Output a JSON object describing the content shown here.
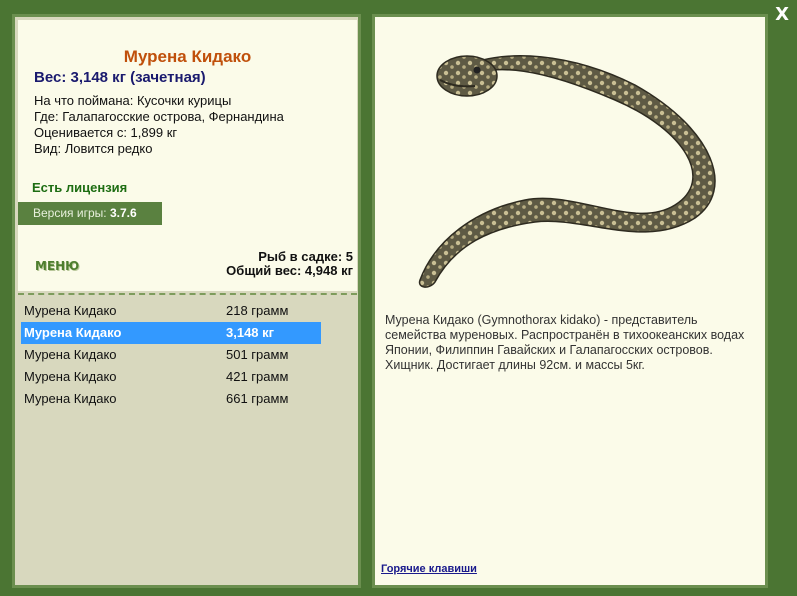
{
  "window": {
    "close_label": "X"
  },
  "fish": {
    "title": "Мурена Кидако",
    "weight": "Вес: 3,148 кг (зачетная)",
    "details": [
      "На что поймана: Кусочки курицы",
      "Где: Галапагосские острова, Фернандина",
      "Оценивается с: 1,899 кг",
      "Вид: Ловится редко"
    ],
    "license": "Есть лицензия",
    "version_label": "Версия игры: ",
    "version_value": "3.7.6",
    "description": "Мурена Кидако (Gymnothorax kidako) - представитель семейства муреновых. Распространён в тихоокеанских водах Японии, Филиппин Гавайских и Галапагосских островов. Хищник. Достигает длины 92см. и массы 5кг."
  },
  "menu_label": "МЕНЮ",
  "stats": {
    "fish_count": "Рыб в садке: 5",
    "total_weight": "Общий вес: 4,948 кг"
  },
  "catch_list": [
    {
      "name": "Мурена Кидако",
      "weight": "218 грамм",
      "selected": false
    },
    {
      "name": "Мурена Кидако",
      "weight": "3,148 кг",
      "selected": true
    },
    {
      "name": "Мурена Кидако",
      "weight": "501 грамм",
      "selected": false
    },
    {
      "name": "Мурена Кидако",
      "weight": "421 грамм",
      "selected": false
    },
    {
      "name": "Мурена Кидако",
      "weight": "661 грамм",
      "selected": false
    }
  ],
  "hotkeys_label": "Горячие клавиши",
  "colors": {
    "frame": "#4b7533",
    "panel": "#fbfbe9",
    "list_bg": "#d8d8be",
    "selection": "#3399ff",
    "title": "#c0500b"
  }
}
